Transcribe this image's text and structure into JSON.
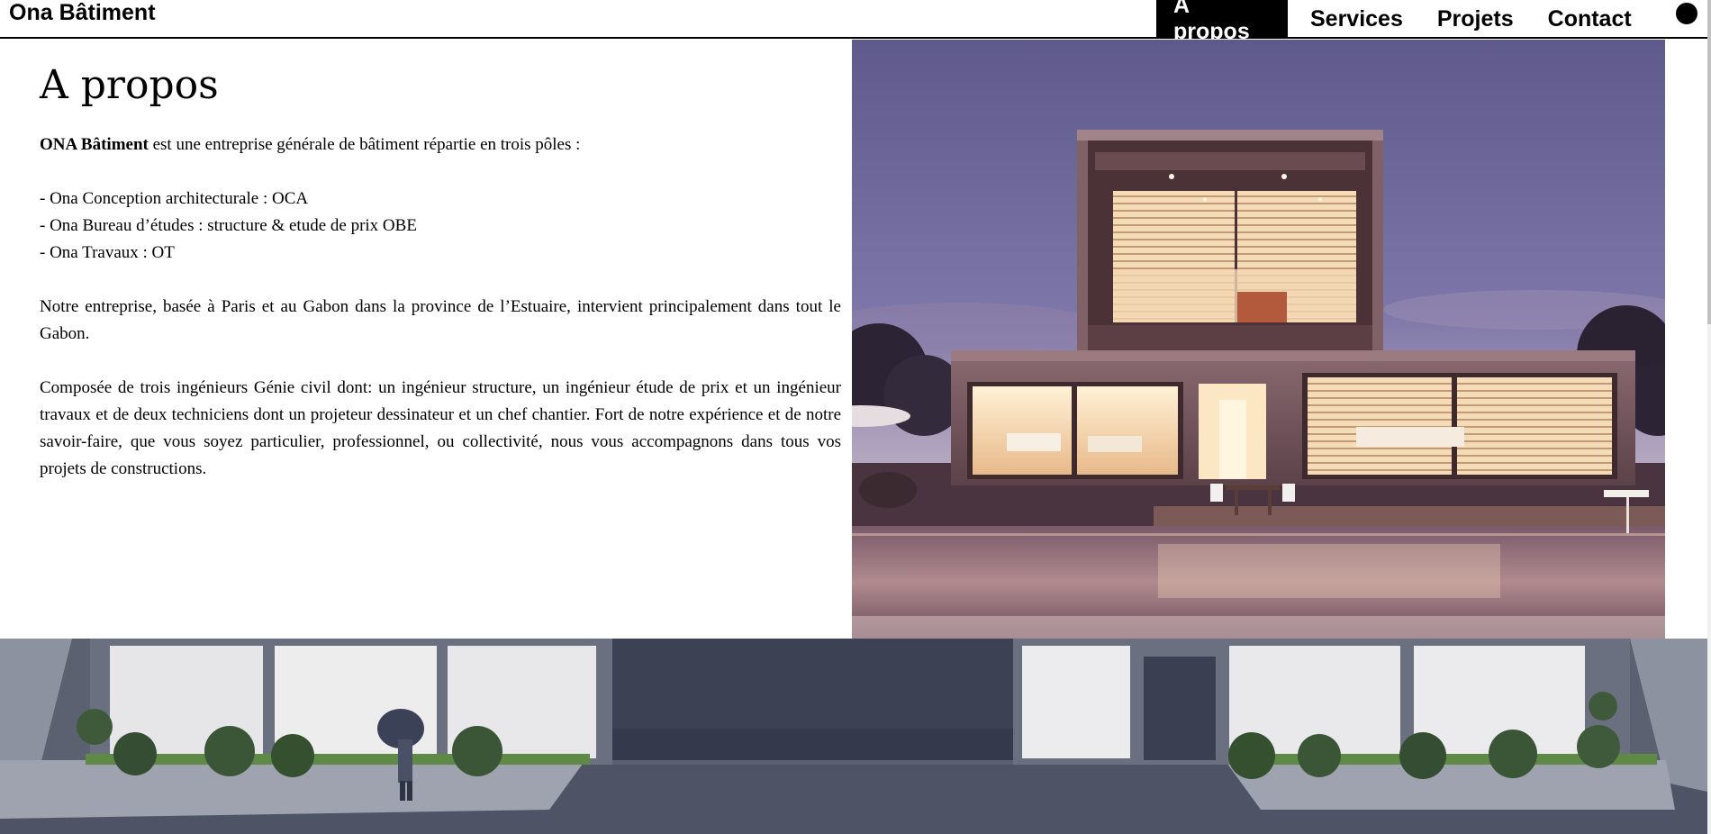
{
  "header": {
    "brand": "Ona Bâtiment",
    "nav": [
      {
        "label": "A propos",
        "active": true
      },
      {
        "label": "Services",
        "active": false
      },
      {
        "label": "Projets",
        "active": false
      },
      {
        "label": "Contact",
        "active": false
      }
    ]
  },
  "about": {
    "title": "A propos",
    "intro_bold": "ONA Bâtiment",
    "intro_rest": " est une entreprise générale de bâtiment répartie en trois pôles :",
    "poles": [
      "- Ona Conception architecturale : OCA",
      "- Ona Bureau d’études : structure & etude de prix OBE",
      "- Ona Travaux : OT"
    ],
    "paragraph1": "Notre entreprise, basée à Paris et au Gabon dans la province de l’Estuaire, intervient principalement dans tout le Gabon.",
    "paragraph2": "Composée de trois ingénieurs Génie civil dont: un ingénieur structure, un ingénieur étude de prix et un ingénieur travaux et de deux techniciens dont un projeteur dessinateur et un chef chantier. Fort de notre expérience et de notre savoir-faire, que vous soyez particulier, professionnel, ou collectivité, nous vous accompagnons dans tous vos projets de constructions."
  },
  "colors": {
    "nav_active_bg": "#000000",
    "nav_active_text": "#ffffff",
    "sky": "#6f6a99",
    "wall_dark": "#3a3f52"
  },
  "icons": {
    "menu": "menu-dot-icon"
  }
}
